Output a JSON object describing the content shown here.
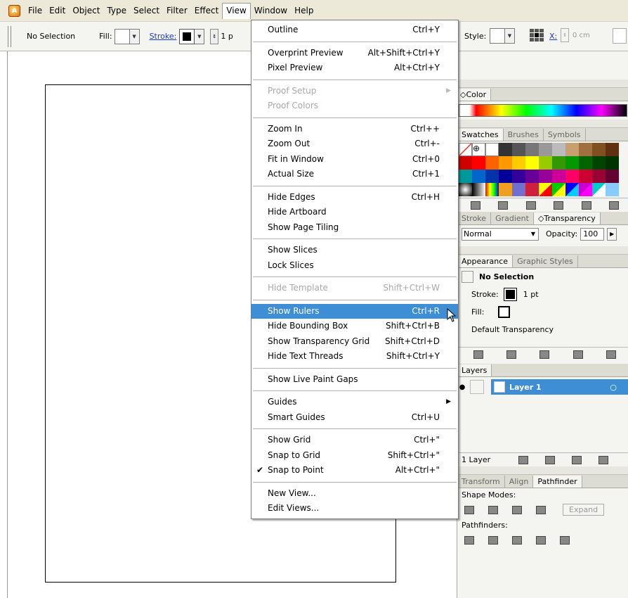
{
  "menubar": {
    "items": [
      "File",
      "Edit",
      "Object",
      "Type",
      "Select",
      "Filter",
      "Effect",
      "View",
      "Window",
      "Help"
    ]
  },
  "control": {
    "selection": "No Selection",
    "fill_label": "Fill:",
    "stroke_label": "Stroke:",
    "stroke_weight": "1 p",
    "style_label": "Style:",
    "x_label": "X:",
    "x_value": "0 cm"
  },
  "view_menu": {
    "groups": [
      [
        {
          "label": "Outline",
          "shortcut": "Ctrl+Y"
        }
      ],
      [
        {
          "label": "Overprint Preview",
          "shortcut": "Alt+Shift+Ctrl+Y"
        },
        {
          "label": "Pixel Preview",
          "shortcut": "Alt+Ctrl+Y"
        }
      ],
      [
        {
          "label": "Proof Setup",
          "shortcut": "",
          "disabled": true,
          "submenu": true
        },
        {
          "label": "Proof Colors",
          "shortcut": "",
          "disabled": true
        }
      ],
      [
        {
          "label": "Zoom In",
          "shortcut": "Ctrl++"
        },
        {
          "label": "Zoom Out",
          "shortcut": "Ctrl+-"
        },
        {
          "label": "Fit in Window",
          "shortcut": "Ctrl+0"
        },
        {
          "label": "Actual Size",
          "shortcut": "Ctrl+1"
        }
      ],
      [
        {
          "label": "Hide Edges",
          "shortcut": "Ctrl+H"
        },
        {
          "label": "Hide Artboard",
          "shortcut": ""
        },
        {
          "label": "Show Page Tiling",
          "shortcut": ""
        }
      ],
      [
        {
          "label": "Show Slices",
          "shortcut": ""
        },
        {
          "label": "Lock Slices",
          "shortcut": ""
        }
      ],
      [
        {
          "label": "Hide Template",
          "shortcut": "Shift+Ctrl+W",
          "disabled": true
        }
      ],
      [
        {
          "label": "Show Rulers",
          "shortcut": "Ctrl+R",
          "highlighted": true
        },
        {
          "label": "Hide Bounding Box",
          "shortcut": "Shift+Ctrl+B"
        },
        {
          "label": "Show Transparency Grid",
          "shortcut": "Shift+Ctrl+D"
        },
        {
          "label": "Hide Text Threads",
          "shortcut": "Shift+Ctrl+Y"
        }
      ],
      [
        {
          "label": "Show Live Paint Gaps",
          "shortcut": ""
        }
      ],
      [
        {
          "label": "Guides",
          "shortcut": "",
          "submenu": true
        },
        {
          "label": "Smart Guides",
          "shortcut": "Ctrl+U"
        }
      ],
      [
        {
          "label": "Show Grid",
          "shortcut": "Ctrl+\""
        },
        {
          "label": "Snap to Grid",
          "shortcut": "Shift+Ctrl+\""
        },
        {
          "label": "Snap to Point",
          "shortcut": "Alt+Ctrl+\"",
          "checked": true
        }
      ],
      [
        {
          "label": "New View...",
          "shortcut": ""
        },
        {
          "label": "Edit Views...",
          "shortcut": ""
        }
      ]
    ]
  },
  "panels": {
    "color_tab": "Color",
    "swatch_tabs": [
      "Swatches",
      "Brushes",
      "Symbols"
    ],
    "stroke_tabs": [
      "Stroke",
      "Gradient",
      "Transparency"
    ],
    "blend_mode": "Normal",
    "opacity_label": "Opacity:",
    "opacity_value": "100",
    "appearance_tabs": [
      "Appearance",
      "Graphic Styles"
    ],
    "appearance_title": "No Selection",
    "appearance_stroke": "Stroke:",
    "appearance_stroke_weight": "1 pt",
    "appearance_fill": "Fill:",
    "appearance_transparency": "Default Transparency",
    "layers_tab": "Layers",
    "layer_name": "Layer 1",
    "layers_count": "1 Layer",
    "pathfinder_tabs": [
      "Transform",
      "Align",
      "Pathfinder"
    ],
    "shape_modes": "Shape Modes:",
    "expand": "Expand",
    "pathfinders": "Pathfinders:"
  },
  "colors": {
    "highlight": "#3d8ed4",
    "layer_selected": "#3d8ed4"
  }
}
